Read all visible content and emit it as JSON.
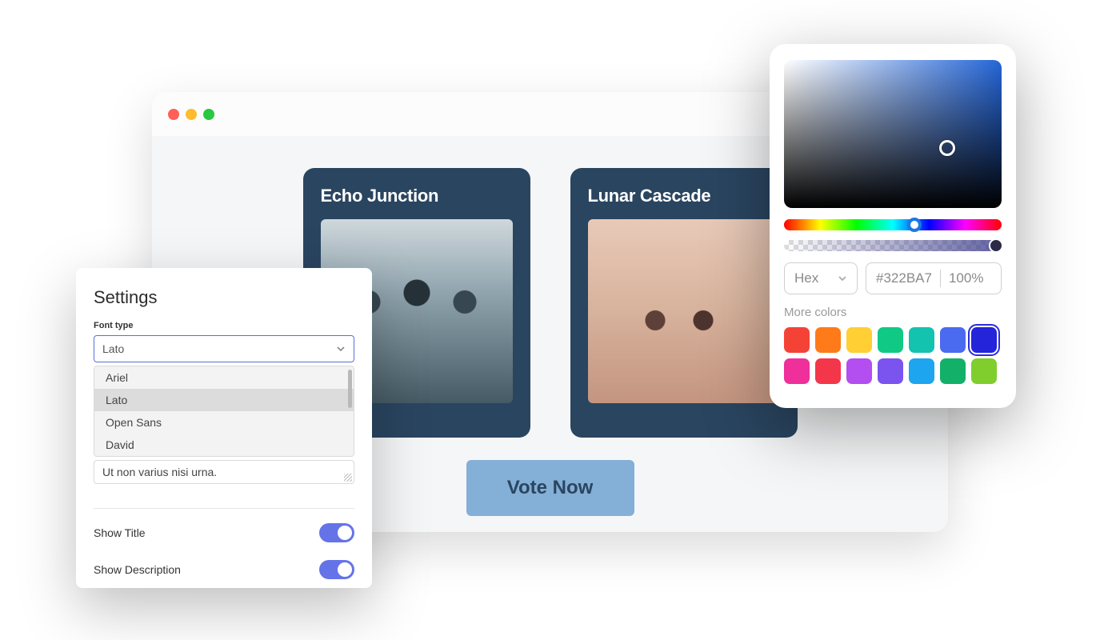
{
  "browser": {
    "cards": [
      {
        "title": "Echo Junction"
      },
      {
        "title": "Lunar Cascade"
      }
    ],
    "vote_button": "Vote Now"
  },
  "settings": {
    "title": "Settings",
    "font_type_label": "Font type",
    "font_selected": "Lato",
    "font_options": [
      "Ariel",
      "Lato",
      "Open Sans",
      "David"
    ],
    "extra_text": "Ut non varius nisi urna.",
    "toggles": [
      {
        "label": "Show Title",
        "value": true
      },
      {
        "label": "Show Description",
        "value": true
      }
    ]
  },
  "color_picker": {
    "format_selected": "Hex",
    "hex_value": "#322BA7",
    "opacity": "100%",
    "more_colors_label": "More colors",
    "swatches": [
      "#f44336",
      "#ff7b1a",
      "#ffcf33",
      "#10c984",
      "#14c2b0",
      "#4a6bf0",
      "#2424db",
      "#ef2f9a",
      "#f4364b",
      "#b34ef0",
      "#7b54ef",
      "#1da5ef",
      "#13b06a",
      "#7fce2e"
    ],
    "selected_swatch_index": 6,
    "colors": {
      "field_primary": "#2566d8"
    }
  }
}
